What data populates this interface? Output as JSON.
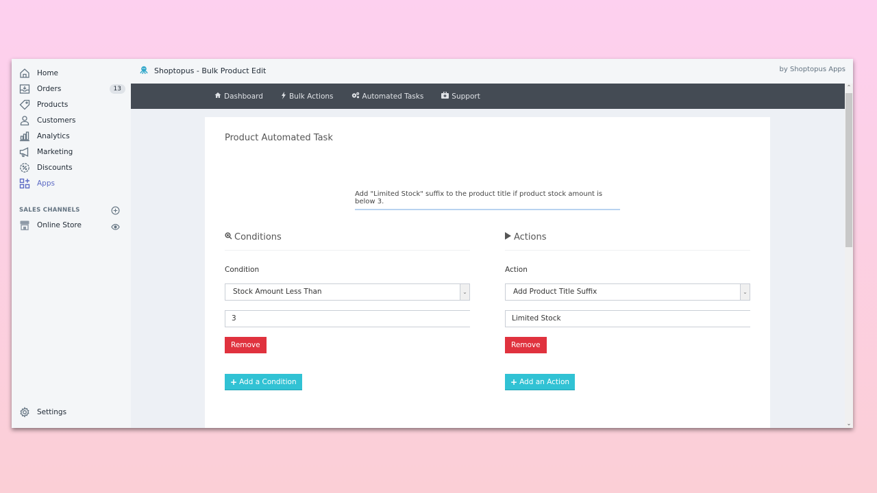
{
  "sidebar": {
    "items": [
      {
        "label": "Home",
        "icon": "home-icon"
      },
      {
        "label": "Orders",
        "icon": "orders-icon",
        "badge": "13"
      },
      {
        "label": "Products",
        "icon": "tag-icon"
      },
      {
        "label": "Customers",
        "icon": "person-icon"
      },
      {
        "label": "Analytics",
        "icon": "bar-chart-icon"
      },
      {
        "label": "Marketing",
        "icon": "megaphone-icon"
      },
      {
        "label": "Discounts",
        "icon": "discount-icon"
      },
      {
        "label": "Apps",
        "icon": "apps-icon",
        "active": true
      }
    ],
    "sales_channels_label": "SALES CHANNELS",
    "online_store_label": "Online Store",
    "settings_label": "Settings"
  },
  "header": {
    "app_title": "Shoptopus - Bulk Product Edit",
    "by_text": "by Shoptopus Apps"
  },
  "topnav": {
    "items": [
      {
        "label": "Dashboard",
        "icon": "home-icon"
      },
      {
        "label": "Bulk Actions",
        "icon": "bolt-icon"
      },
      {
        "label": "Automated Tasks",
        "icon": "gears-icon"
      },
      {
        "label": "Support",
        "icon": "medkit-icon"
      }
    ]
  },
  "card": {
    "title": "Product Automated Task",
    "description": "Add \"Limited Stock\" suffix to the product title if product stock amount is below 3.",
    "conditions": {
      "heading": "Conditions",
      "field_label": "Condition",
      "select_value": "Stock Amount Less Than",
      "input_value": "3",
      "remove_label": "Remove",
      "add_label": "Add a Condition"
    },
    "actions": {
      "heading": "Actions",
      "field_label": "Action",
      "select_value": "Add Product Title Suffix",
      "input_value": "Limited Stock",
      "remove_label": "Remove",
      "add_label": "Add an Action"
    }
  },
  "colors": {
    "accent": "#5c6ac4",
    "danger": "#e0323e",
    "info": "#31c2d4",
    "nav_bg": "#444b54"
  }
}
